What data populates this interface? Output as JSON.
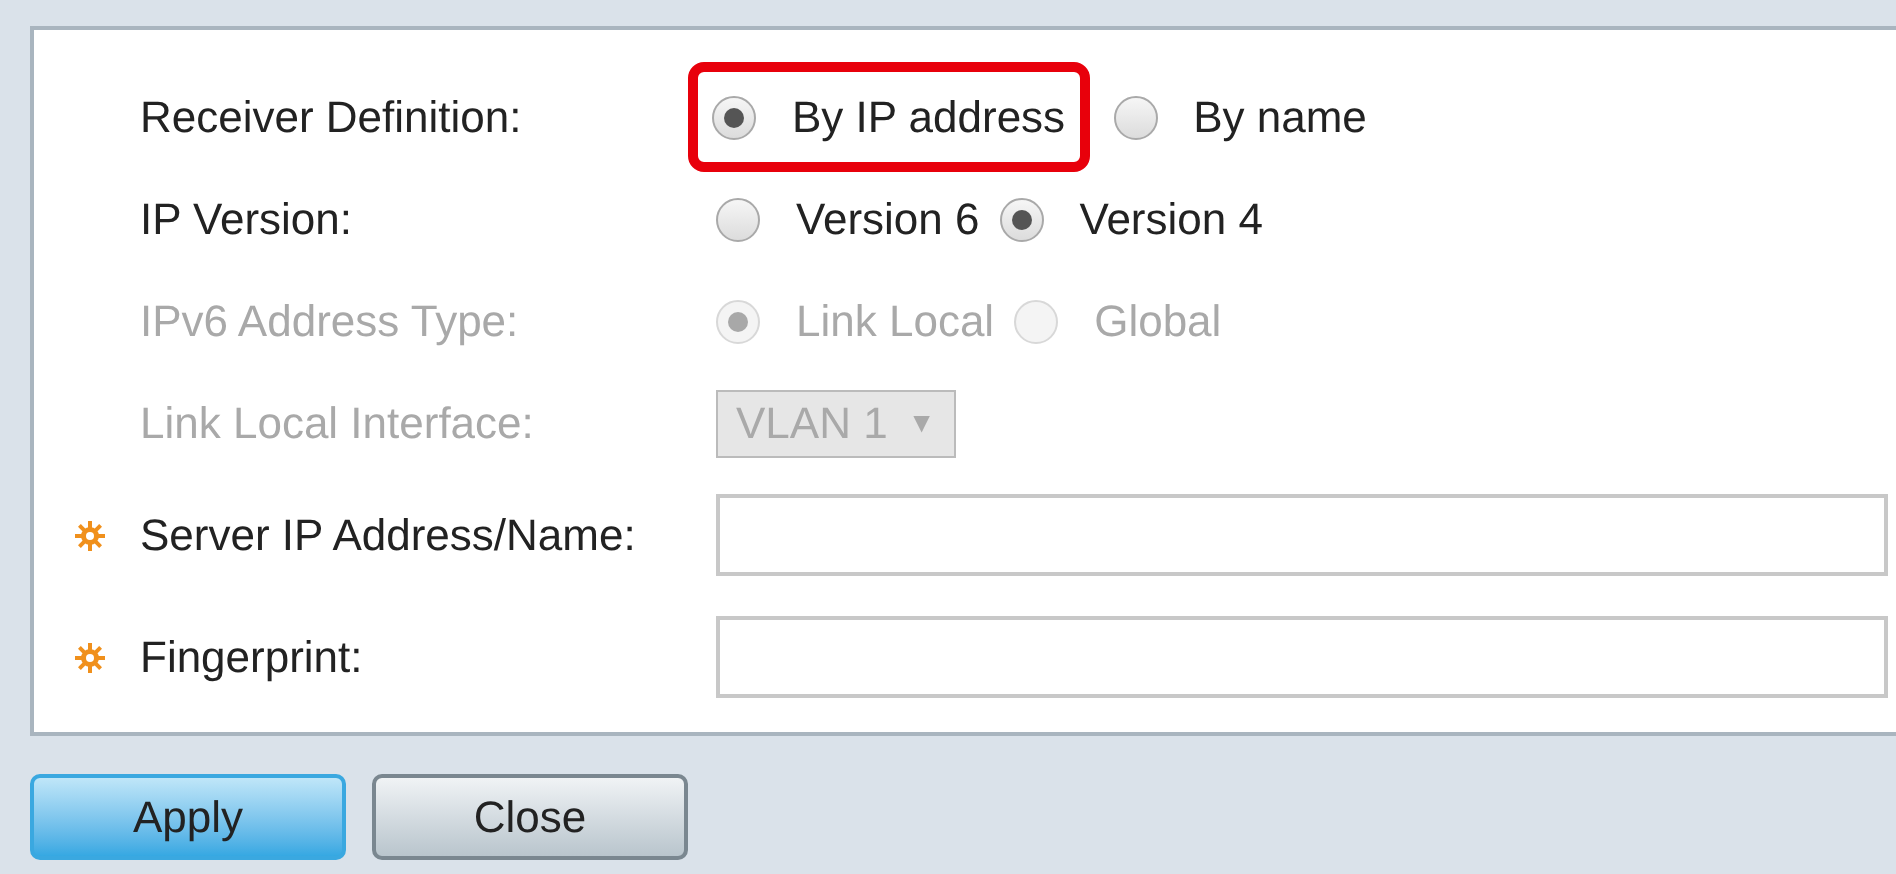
{
  "fields": [
    {
      "kind": "radio",
      "label": "Receiver Definition:",
      "disabled": false,
      "options": [
        {
          "label": "By IP address",
          "selected": true,
          "highlighted": true
        },
        {
          "label": "By name",
          "selected": false,
          "highlighted": false
        }
      ]
    },
    {
      "kind": "radio",
      "label": "IP Version:",
      "disabled": false,
      "options": [
        {
          "label": "Version 6",
          "selected": false,
          "highlighted": false
        },
        {
          "label": "Version 4",
          "selected": true,
          "highlighted": false
        }
      ]
    },
    {
      "kind": "radio",
      "label": "IPv6 Address Type:",
      "disabled": true,
      "options": [
        {
          "label": "Link Local",
          "selected": true,
          "highlighted": false
        },
        {
          "label": "Global",
          "selected": false,
          "highlighted": false
        }
      ]
    },
    {
      "kind": "select",
      "label": "Link Local Interface:",
      "disabled": true,
      "value": "VLAN 1",
      "caret": "▼"
    },
    {
      "kind": "text",
      "label": "Server IP Address/Name:",
      "required": true
    },
    {
      "kind": "text",
      "label": "Fingerprint:",
      "required": true
    }
  ],
  "buttons": [
    {
      "label": "Apply",
      "kind": "primary"
    },
    {
      "label": "Close",
      "kind": "secondary"
    }
  ]
}
